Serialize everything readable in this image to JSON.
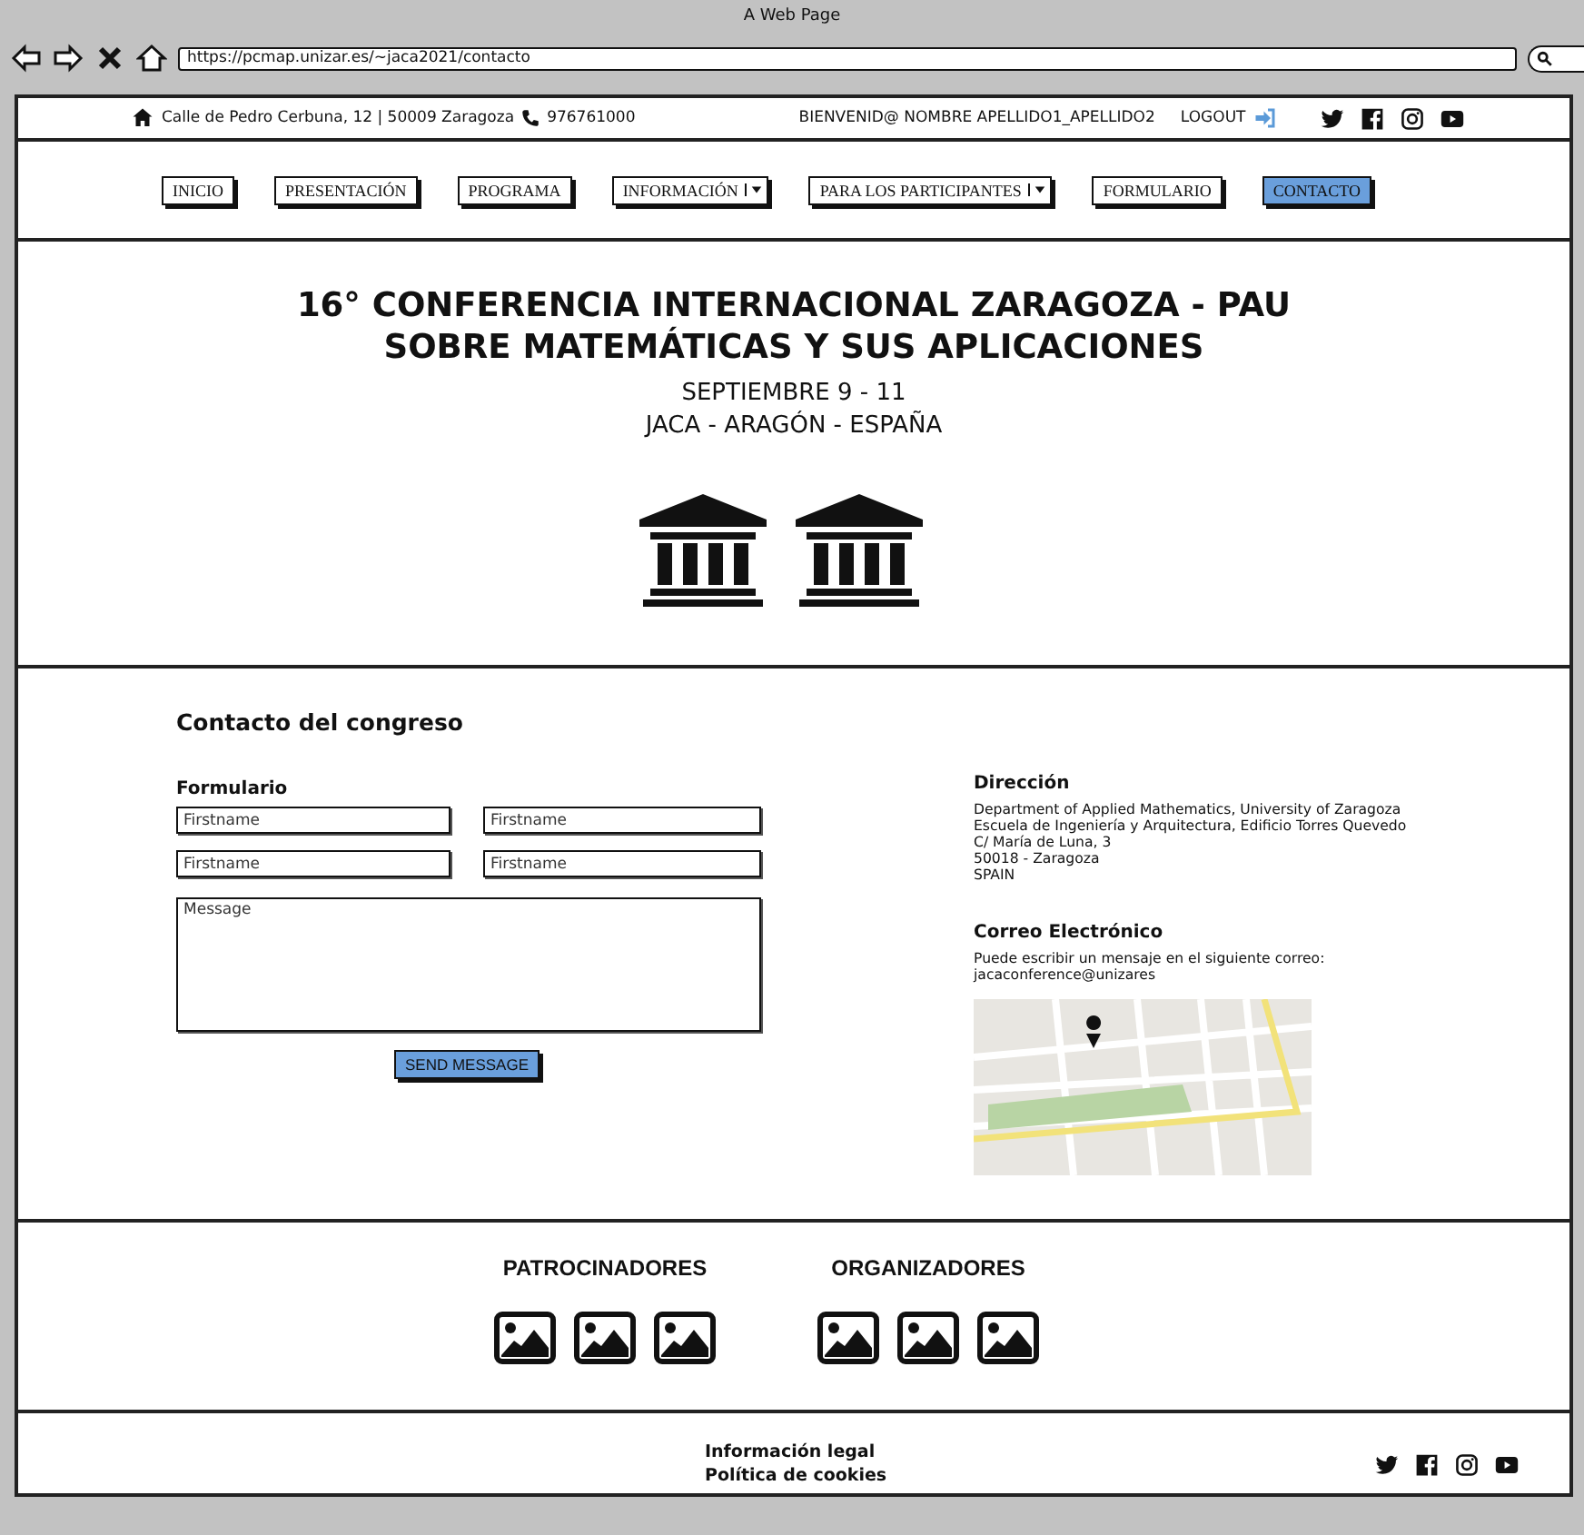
{
  "browser": {
    "title": "A Web Page",
    "url": "https://pcmap.unizar.es/~jaca2021/contacto"
  },
  "top_bar": {
    "address": "Calle de Pedro Cerbuna, 12 | 50009 Zaragoza",
    "phone": "976761000",
    "welcome": "BIENVENID@ NOMBRE APELLIDO1_APELLIDO2",
    "logout": "LOGOUT"
  },
  "nav": [
    {
      "label": "INICIO",
      "kind": "button",
      "selected": false
    },
    {
      "label": "PRESENTACIÓN",
      "kind": "button",
      "selected": false
    },
    {
      "label": "PROGRAMA",
      "kind": "button",
      "selected": false
    },
    {
      "label": "INFORMACIÓN",
      "kind": "dropdown",
      "selected": false
    },
    {
      "label": "PARA LOS PARTICIPANTES",
      "kind": "dropdown",
      "selected": false
    },
    {
      "label": "FORMULARIO",
      "kind": "button",
      "selected": false
    },
    {
      "label": "CONTACTO",
      "kind": "button",
      "selected": true
    }
  ],
  "hero": {
    "title_lines": [
      "16° CONFERENCIA INTERNACIONAL ZARAGOZA - PAU",
      "SOBRE MATEMÁTICAS Y SUS APLICACIONES"
    ],
    "subtitle_lines": [
      "SEPTIEMBRE 9 - 11",
      "JACA - ARAGÓN - ESPAÑA"
    ]
  },
  "contact": {
    "heading": "Contacto del congreso",
    "form": {
      "heading": "Formulario",
      "fields": [
        {
          "placeholder": "Firstname"
        },
        {
          "placeholder": "Firstname"
        },
        {
          "placeholder": "Firstname"
        },
        {
          "placeholder": "Firstname"
        }
      ],
      "message": {
        "placeholder": "Message"
      },
      "submit": "SEND MESSAGE"
    },
    "address": {
      "heading": "Dirección",
      "lines": [
        "Department of Applied Mathematics, University of Zaragoza",
        "Escuela de Ingeniería y Arquitectura, Edificio Torres Quevedo",
        "C/ María de Luna, 3",
        "50018 - Zaragoza",
        "SPAIN"
      ]
    },
    "email": {
      "heading": "Correo Electrónico",
      "lines": [
        "Puede escribir un mensaje en el siguiente correo:",
        "jacaconference@unizares"
      ]
    }
  },
  "logo_groups": [
    {
      "heading": "PATROCINADORES"
    },
    {
      "heading": "ORGANIZADORES"
    }
  ],
  "footer": {
    "links": [
      "Información legal",
      "Política de cookies"
    ]
  }
}
